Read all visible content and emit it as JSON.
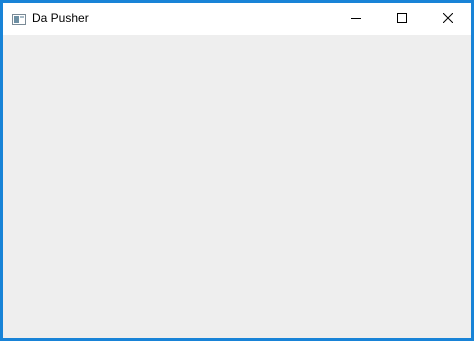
{
  "window": {
    "title": "Da Pusher",
    "border_color": "#1883d7",
    "client_background": "#eeeeee",
    "icons": {
      "app": "app-window-icon",
      "minimize": "minimize-icon",
      "maximize": "maximize-icon",
      "close": "close-icon"
    }
  }
}
